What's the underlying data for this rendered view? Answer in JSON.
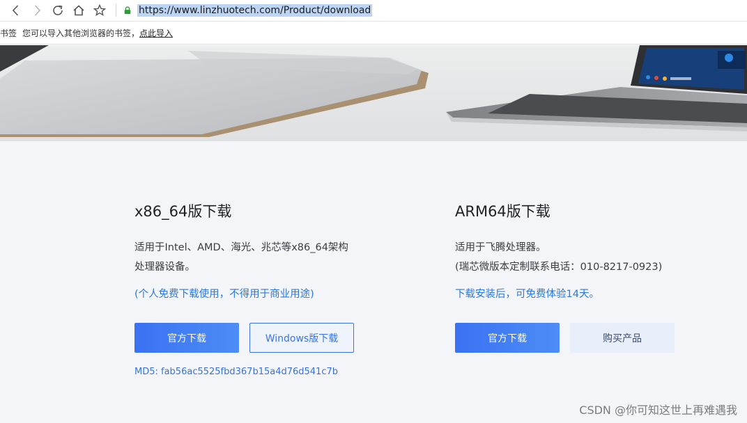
{
  "browser": {
    "url": "https://www.linzhuotech.com/Product/download"
  },
  "bookmarks": {
    "label": "书签",
    "import_text": "您可以导入其他浏览器的书签，",
    "import_link": "点此导入"
  },
  "x86": {
    "title": "x86_64版下载",
    "desc_line1": "适用于Intel、AMD、海光、兆芯等x86_64架构",
    "desc_line2": "处理器设备。",
    "note": "(个人免费下载使用，不得用于商业用途)",
    "official_download": "官方下载",
    "windows_download": "Windows版下载",
    "md5": "MD5: fab56ac5525fbd367b15a4d76d541c7b"
  },
  "arm": {
    "title": "ARM64版下载",
    "desc_line1": "适用于飞腾处理器。",
    "desc_line2": "(瑞芯微版本定制联系电话：010-8217-0923)",
    "note": "下载安装后，可免费体验14天。",
    "official_download": "官方下载",
    "buy": "购买产品"
  },
  "watermark": "CSDN @你可知这世上再难遇我",
  "colors": {
    "primary": "#3a72f2",
    "link": "#2b78df",
    "content_bg": "#f3f5f8"
  }
}
